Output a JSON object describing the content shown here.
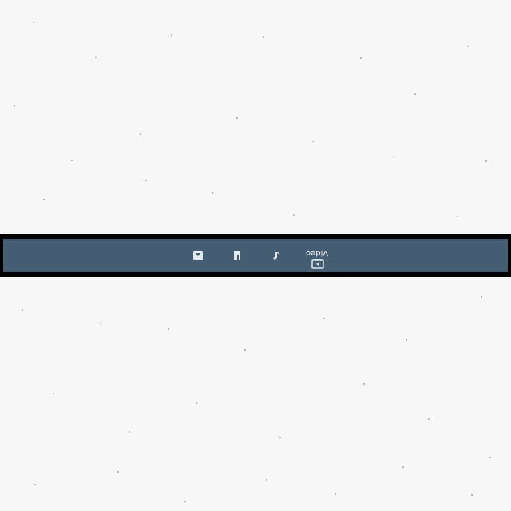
{
  "bottom_nav": {
    "tabs": [
      {
        "id": "photos",
        "icon": "image-icon",
        "label": ""
      },
      {
        "id": "documents",
        "icon": "document-icon",
        "label": ""
      },
      {
        "id": "music",
        "icon": "music-note-icon",
        "label": ""
      },
      {
        "id": "video",
        "icon": "video-icon",
        "label": "Video"
      }
    ]
  },
  "colors": {
    "background": "#f7f7f7",
    "bar_border": "#000000",
    "bar_fill": "#445d73",
    "icon": "#dfe6ec"
  }
}
